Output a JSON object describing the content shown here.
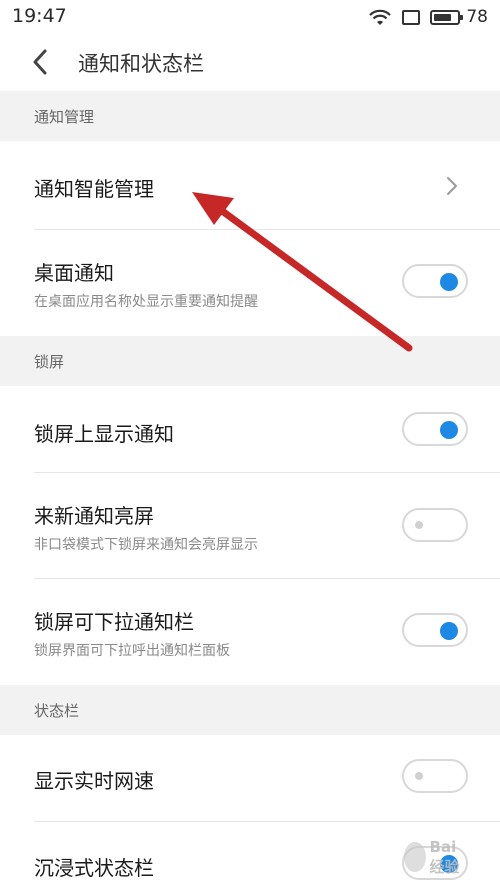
{
  "status_bar": {
    "time": "19:47",
    "battery_level": "78",
    "battery_fraction": 0.78,
    "icons": [
      "wifi-icon",
      "screen-icon",
      "battery-icon"
    ]
  },
  "header": {
    "back_icon": "back-arrow-icon",
    "title": "通知和状态栏"
  },
  "sections": {
    "notification_management": {
      "header": "通知管理",
      "smart_management": {
        "title": "通知智能管理",
        "icon": "chevron-right-icon"
      },
      "desktop_notification": {
        "title": "桌面通知",
        "subtitle": "在桌面应用名称处显示重要通知提醒",
        "enabled": true
      }
    },
    "lock_screen": {
      "header": "锁屏",
      "show_on_lock": {
        "title": "锁屏上显示通知",
        "enabled": true
      },
      "wake_on_notify": {
        "title": "来新通知亮屏",
        "subtitle": "非口袋模式下锁屏来通知会亮屏显示",
        "enabled": false
      },
      "pull_down_on_lock": {
        "title": "锁屏可下拉通知栏",
        "subtitle": "锁屏界面可下拉呼出通知栏面板",
        "enabled": true
      }
    },
    "status_bar_section": {
      "header": "状态栏",
      "realtime_speed": {
        "title": "显示实时网速",
        "enabled": false
      },
      "immersive": {
        "title": "沉浸式状态栏",
        "enabled": true
      }
    }
  },
  "annotation": {
    "arrow_color": "#c62828",
    "target": "通知智能管理"
  },
  "colors": {
    "accent": "#1e88e5",
    "section_bg": "#f2f2f2"
  },
  "watermark": {
    "text": "Bai  经验"
  }
}
